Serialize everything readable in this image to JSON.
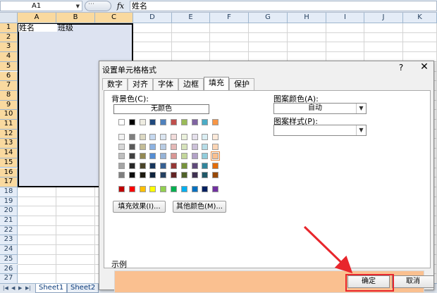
{
  "formula_bar": {
    "cell_ref": "A1",
    "fx_label": "fx",
    "content": "姓名"
  },
  "sheet": {
    "columns": [
      "A",
      "B",
      "C",
      "D",
      "E",
      "F",
      "G",
      "H",
      "I",
      "J",
      "K"
    ],
    "rows": [
      "1",
      "2",
      "3",
      "4",
      "5",
      "6",
      "7",
      "8",
      "9",
      "10",
      "11",
      "12",
      "13",
      "14",
      "15",
      "16",
      "17",
      "18",
      "19",
      "20",
      "21",
      "22",
      "23",
      "24",
      "25",
      "26",
      "27"
    ],
    "cells": {
      "A1": "姓名",
      "B1": "班级"
    },
    "tabs": [
      "Sheet1",
      "Sheet2"
    ]
  },
  "dialog": {
    "title": "设置单元格格式",
    "help_label": "?",
    "close_label": "✕",
    "tabs": [
      "数字",
      "对齐",
      "字体",
      "边框",
      "填充",
      "保护"
    ],
    "active_tab": "填充",
    "background_color_label": "背景色(C):",
    "no_color_label": "无颜色",
    "fill_effects_button": "填充效果(I)...",
    "more_colors_button": "其他颜色(M)...",
    "pattern_color_label": "图案颜色(A):",
    "pattern_color_value": "自动",
    "pattern_style_label": "图案样式(P):",
    "pattern_style_value": "",
    "sample_label": "示例",
    "sample_color": "#fac090",
    "ok_button": "确定",
    "cancel_button": "取消",
    "palette_row1": [
      "#ffffff",
      "#000000",
      "#eeece1",
      "#1f497d",
      "#4f81bd",
      "#c0504d",
      "#9bbb59",
      "#8064a2",
      "#4bacc6",
      "#f79646"
    ],
    "palette_theme": [
      [
        "#f2f2f2",
        "#7f7f7f",
        "#ddd9c3",
        "#c6d9f0",
        "#dbe5f1",
        "#f2dcdb",
        "#ebf1dd",
        "#e5e0ec",
        "#dbeef3",
        "#fdeada"
      ],
      [
        "#d8d8d8",
        "#595959",
        "#c4bd97",
        "#8db3e2",
        "#b8cce4",
        "#e5b9b7",
        "#d7e3bc",
        "#ccc1d9",
        "#b7dde8",
        "#fbd5b5"
      ],
      [
        "#bfbfbf",
        "#3f3f3f",
        "#938953",
        "#548dd4",
        "#95b3d7",
        "#d99694",
        "#c3d69b",
        "#b2a2c7",
        "#92cddc",
        "#fac08f"
      ],
      [
        "#a5a5a5",
        "#262626",
        "#494429",
        "#17365d",
        "#366092",
        "#953734",
        "#76923c",
        "#5f497a",
        "#31859b",
        "#e36c09"
      ],
      [
        "#7f7f7f",
        "#0c0c0c",
        "#1d1b10",
        "#0f243e",
        "#244061",
        "#632423",
        "#4f6128",
        "#3f3151",
        "#205867",
        "#974806"
      ]
    ],
    "palette_standard": [
      "#c00000",
      "#ff0000",
      "#ffc000",
      "#ffff00",
      "#92d050",
      "#00b050",
      "#00b0f0",
      "#0070c0",
      "#002060",
      "#7030a0"
    ],
    "selected_swatch": "#fac08f"
  },
  "annotation": {
    "highlight_color": "#e8262c"
  }
}
